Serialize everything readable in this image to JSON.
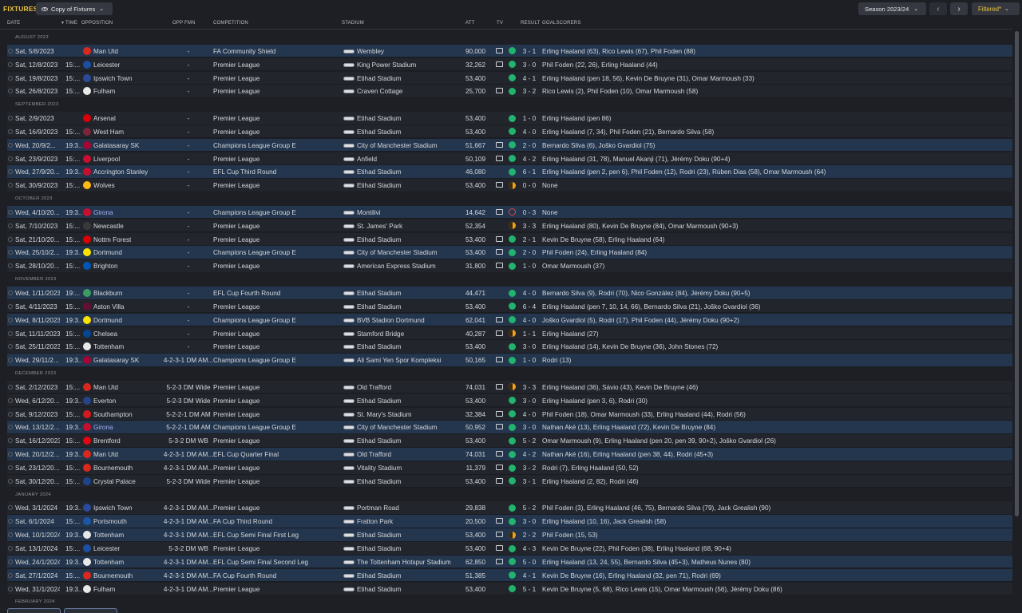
{
  "header": {
    "title": "FIXTURES",
    "view": "Copy of Fixtures",
    "season": "Season 2023/24",
    "filter": "Filtered*"
  },
  "columns": {
    "date": "DATE",
    "time": "TIME",
    "opposition": "OPPOSITION",
    "opp_fmn": "OPP FMN",
    "competition": "COMPETITION",
    "stadium": "STADIUM",
    "att": "ATT",
    "tv": "TV",
    "result": "RESULT",
    "goalscorers": "GOALSCORERS"
  },
  "colors": {
    "accent": "#e9c23b",
    "win": "#22b36f",
    "draw": "#f0a11f",
    "loss": "#e24848",
    "highlight_row": "#23364e"
  },
  "groups": [
    {
      "month": "AUGUST 2023",
      "rows": [
        {
          "date": "Sat, 5/8/2023",
          "time": "",
          "opp": "Man Utd",
          "crest": "#d9291c",
          "fmn": "-",
          "comp": "FA Community Shield",
          "stadium": "Wembley",
          "att": "90,000",
          "tv": true,
          "res": "w",
          "score": "3 - 1",
          "goals": "Erling Haaland (63), Rico Lewis (67), Phil Foden (88)",
          "hl": true
        },
        {
          "date": "Sat, 12/8/2023",
          "time": "15:...",
          "opp": "Leicester",
          "crest": "#1c4fa3",
          "fmn": "-",
          "comp": "Premier League",
          "stadium": "King Power Stadium",
          "att": "32,262",
          "tv": true,
          "res": "w",
          "score": "3 - 0",
          "goals": "Phil Foden (22, 26), Erling Haaland (44)"
        },
        {
          "date": "Sat, 19/8/2023",
          "time": "15:...",
          "opp": "Ipswich Town",
          "crest": "#2a4a9c",
          "fmn": "-",
          "comp": "Premier League",
          "stadium": "Etihad Stadium",
          "att": "53,400",
          "tv": false,
          "res": "w",
          "score": "4 - 1",
          "goals": "Erling Haaland (pen 18, 56), Kevin De Bruyne (31), Omar Marmoush (33)"
        },
        {
          "date": "Sat, 26/8/2023",
          "time": "15:...",
          "opp": "Fulham",
          "crest": "#e8e8e8",
          "fmn": "-",
          "comp": "Premier League",
          "stadium": "Craven Cottage",
          "att": "25,700",
          "tv": true,
          "res": "w",
          "score": "3 - 2",
          "goals": "Rico Lewis (2), Phil Foden (10), Omar Marmoush (58)"
        }
      ]
    },
    {
      "month": "SEPTEMBER 2023",
      "rows": [
        {
          "date": "Sat, 2/9/2023",
          "time": "",
          "opp": "Arsenal",
          "crest": "#db0007",
          "fmn": "-",
          "comp": "Premier League",
          "stadium": "Etihad Stadium",
          "att": "53,400",
          "tv": false,
          "res": "w",
          "score": "1 - 0",
          "goals": "Erling Haaland (pen 86)"
        },
        {
          "date": "Sat, 16/9/2023",
          "time": "15:...",
          "opp": "West Ham",
          "crest": "#7a263a",
          "fmn": "-",
          "comp": "Premier League",
          "stadium": "Etihad Stadium",
          "att": "53,400",
          "tv": false,
          "res": "w",
          "score": "4 - 0",
          "goals": "Erling Haaland (7, 34), Phil Foden (21), Bernardo Silva (58)"
        },
        {
          "date": "Wed, 20/9/2...",
          "time": "19:3...",
          "opp": "Galatasaray SK",
          "crest": "#a90432",
          "fmn": "-",
          "comp": "Champions League Group E",
          "stadium": "City of Manchester Stadium",
          "att": "51,667",
          "tv": true,
          "res": "w",
          "score": "2 - 0",
          "goals": "Bernardo Silva (6), Joško Gvardiol (75)",
          "hl": true
        },
        {
          "date": "Sat, 23/9/2023",
          "time": "15:...",
          "opp": "Liverpool",
          "crest": "#c8102e",
          "fmn": "-",
          "comp": "Premier League",
          "stadium": "Anfield",
          "att": "50,109",
          "tv": true,
          "res": "w",
          "score": "4 - 2",
          "goals": "Erling Haaland (31, 78), Manuel Akanji (71), Jérémy Doku (90+4)"
        },
        {
          "date": "Wed, 27/9/20...",
          "time": "19:3...",
          "opp": "Accrington Stanley",
          "crest": "#c8102e",
          "fmn": "-",
          "comp": "EFL Cup Third Round",
          "stadium": "Etihad Stadium",
          "att": "46,080",
          "tv": false,
          "res": "w",
          "score": "6 - 1",
          "goals": "Erling Haaland (pen 2, pen 6), Phil Foden (12), Rodri (23), Rúben Dias (58), Omar Marmoush (64)",
          "hl": true
        },
        {
          "date": "Sat, 30/9/2023",
          "time": "15:...",
          "opp": "Wolves",
          "crest": "#fdb913",
          "fmn": "-",
          "comp": "Premier League",
          "stadium": "Etihad Stadium",
          "att": "53,400",
          "tv": true,
          "res": "d",
          "score": "0 - 0",
          "goals": "None"
        }
      ]
    },
    {
      "month": "OCTOBER 2023",
      "rows": [
        {
          "date": "Wed, 4/10/20...",
          "time": "19:3...",
          "opp": "Girona",
          "crest": "#c8102e",
          "fmn": "-",
          "comp": "Champions League Group E",
          "stadium": "Montilivi",
          "att": "14,642",
          "tv": true,
          "res": "l",
          "score": "0 - 3",
          "goals": "None",
          "hl": true,
          "girona": true
        },
        {
          "date": "Sat, 7/10/2023",
          "time": "15:...",
          "opp": "Newcastle",
          "crest": "#3a3a3a",
          "fmn": "-",
          "comp": "Premier League",
          "stadium": "St. James' Park",
          "att": "52,354",
          "tv": false,
          "res": "d",
          "score": "3 - 3",
          "goals": "Erling Haaland (80), Kevin De Bruyne (84), Omar Marmoush (90+3)"
        },
        {
          "date": "Sat, 21/10/20...",
          "time": "15:...",
          "opp": "Nottm Forest",
          "crest": "#dd0000",
          "fmn": "-",
          "comp": "Premier League",
          "stadium": "Etihad Stadium",
          "att": "53,400",
          "tv": true,
          "res": "w",
          "score": "2 - 1",
          "goals": "Kevin De Bruyne (58), Erling Haaland (64)"
        },
        {
          "date": "Wed, 25/10/2...",
          "time": "19:3...",
          "opp": "Dortmund",
          "crest": "#fde100",
          "fmn": "-",
          "comp": "Champions League Group E",
          "stadium": "City of Manchester Stadium",
          "att": "53,400",
          "tv": true,
          "res": "w",
          "score": "2 - 0",
          "goals": "Phil Foden (24), Erling Haaland (84)",
          "hl": true
        },
        {
          "date": "Sat, 28/10/20...",
          "time": "15:...",
          "opp": "Brighton",
          "crest": "#0057b8",
          "fmn": "-",
          "comp": "Premier League",
          "stadium": "American Express Stadium",
          "att": "31,800",
          "tv": true,
          "res": "w",
          "score": "1 - 0",
          "goals": "Omar Marmoush (37)"
        }
      ]
    },
    {
      "month": "NOVEMBER 2023",
      "rows": [
        {
          "date": "Wed, 1/11/2023",
          "time": "19:...",
          "opp": "Blackburn",
          "crest": "#3c9a63",
          "fmn": "-",
          "comp": "EFL Cup Fourth Round",
          "stadium": "Etihad Stadium",
          "att": "44,471",
          "tv": false,
          "res": "w",
          "score": "4 - 0",
          "goals": "Bernardo Silva (9), Rodri (70), Nico González (84), Jérémy Doku (90+5)",
          "hl": true
        },
        {
          "date": "Sat, 4/11/2023",
          "time": "15:...",
          "opp": "Aston Villa",
          "crest": "#670e36",
          "fmn": "-",
          "comp": "Premier League",
          "stadium": "Etihad Stadium",
          "att": "53,400",
          "tv": false,
          "res": "w",
          "score": "6 - 4",
          "goals": "Erling Haaland (pen 7, 10, 14, 66), Bernardo Silva (21), Joško Gvardiol (36)"
        },
        {
          "date": "Wed, 8/11/2023",
          "time": "19:3...",
          "opp": "Dortmund",
          "crest": "#fde100",
          "fmn": "-",
          "comp": "Champions League Group E",
          "stadium": "BVB Stadion Dortmund",
          "att": "62,041",
          "tv": true,
          "res": "w",
          "score": "4 - 0",
          "goals": "Joško Gvardiol (5), Rodri (17), Phil Foden (44), Jérémy Doku (90+2)",
          "hl": true
        },
        {
          "date": "Sat, 11/11/2023",
          "time": "15:...",
          "opp": "Chelsea",
          "crest": "#034694",
          "fmn": "-",
          "comp": "Premier League",
          "stadium": "Stamford Bridge",
          "att": "40,287",
          "tv": true,
          "res": "d",
          "score": "1 - 1",
          "goals": "Erling Haaland (27)"
        },
        {
          "date": "Sat, 25/11/2023",
          "time": "15:...",
          "opp": "Tottenham",
          "crest": "#e8e8e8",
          "fmn": "-",
          "comp": "Premier League",
          "stadium": "Etihad Stadium",
          "att": "53,400",
          "tv": false,
          "res": "w",
          "score": "3 - 0",
          "goals": "Erling Haaland (14), Kevin De Bruyne (36), John Stones (72)"
        },
        {
          "date": "Wed, 29/11/2...",
          "time": "19:3...",
          "opp": "Galatasaray SK",
          "crest": "#a90432",
          "fmn": "4-2-3-1 DM AM...",
          "comp": "Champions League Group E",
          "stadium": "Ali Sami Yen Spor Kompleksi",
          "att": "50,165",
          "tv": true,
          "res": "w",
          "score": "1 - 0",
          "goals": "Rodri (13)",
          "hl": true
        }
      ]
    },
    {
      "month": "DECEMBER 2023",
      "rows": [
        {
          "date": "Sat, 2/12/2023",
          "time": "15:...",
          "opp": "Man Utd",
          "crest": "#d9291c",
          "fmn": "5-2-3 DM Wide",
          "comp": "Premier League",
          "stadium": "Old Trafford",
          "att": "74,031",
          "tv": true,
          "res": "d",
          "score": "3 - 3",
          "goals": "Erling Haaland (36), Sávio (43), Kevin De Bruyne (46)"
        },
        {
          "date": "Wed, 6/12/20...",
          "time": "19:3...",
          "opp": "Everton",
          "crest": "#274488",
          "fmn": "5-2-3 DM Wide",
          "comp": "Premier League",
          "stadium": "Etihad Stadium",
          "att": "53,400",
          "tv": false,
          "res": "w",
          "score": "3 - 0",
          "goals": "Erling Haaland (pen 3, 6), Rodri (30)"
        },
        {
          "date": "Sat, 9/12/2023",
          "time": "15:...",
          "opp": "Southampton",
          "crest": "#d71920",
          "fmn": "5-2-2-1 DM AM",
          "comp": "Premier League",
          "stadium": "St. Mary's Stadium",
          "att": "32,384",
          "tv": true,
          "res": "w",
          "score": "4 - 0",
          "goals": "Phil Foden (18), Omar Marmoush (33), Erling Haaland (44), Rodri (56)"
        },
        {
          "date": "Wed, 13/12/2...",
          "time": "19:3...",
          "opp": "Girona",
          "crest": "#c8102e",
          "fmn": "5-2-2-1 DM AM",
          "comp": "Champions League Group E",
          "stadium": "City of Manchester Stadium",
          "att": "50,952",
          "tv": true,
          "res": "w",
          "score": "3 - 0",
          "goals": "Nathan Aké (13), Erling Haaland (72), Kevin De Bruyne (84)",
          "hl": true,
          "girona": true
        },
        {
          "date": "Sat, 16/12/2023",
          "time": "15:...",
          "opp": "Brentford",
          "crest": "#e30613",
          "fmn": "5-3-2 DM WB",
          "comp": "Premier League",
          "stadium": "Etihad Stadium",
          "att": "53,400",
          "tv": false,
          "res": "w",
          "score": "5 - 2",
          "goals": "Omar Marmoush (9), Erling Haaland (pen 20, pen 39, 90+2), Joško Gvardiol (26)"
        },
        {
          "date": "Wed, 20/12/2...",
          "time": "19:3...",
          "opp": "Man Utd",
          "crest": "#d9291c",
          "fmn": "4-2-3-1 DM AM...",
          "comp": "EFL Cup Quarter Final",
          "stadium": "Old Trafford",
          "att": "74,031",
          "tv": true,
          "res": "w",
          "score": "4 - 2",
          "goals": "Nathan Aké (16), Erling Haaland (pen 38, 44), Rodri (45+3)",
          "hl": true
        },
        {
          "date": "Sat, 23/12/20...",
          "time": "15:...",
          "opp": "Bournemouth",
          "crest": "#da291c",
          "fmn": "4-2-3-1 DM AM...",
          "comp": "Premier League",
          "stadium": "Vitality Stadium",
          "att": "11,379",
          "tv": true,
          "res": "w",
          "score": "3 - 2",
          "goals": "Rodri (7), Erling Haaland (50, 52)"
        },
        {
          "date": "Sat, 30/12/20...",
          "time": "15:...",
          "opp": "Crystal Palace",
          "crest": "#1b458f",
          "fmn": "5-2-3 DM Wide",
          "comp": "Premier League",
          "stadium": "Etihad Stadium",
          "att": "53,400",
          "tv": true,
          "res": "w",
          "score": "3 - 1",
          "goals": "Erling Haaland (2, 82), Rodri (46)"
        }
      ]
    },
    {
      "month": "JANUARY 2024",
      "rows": [
        {
          "date": "Wed, 3/1/2024",
          "time": "19:3...",
          "opp": "Ipswich Town",
          "crest": "#2a4a9c",
          "fmn": "4-2-3-1 DM AM...",
          "comp": "Premier League",
          "stadium": "Portman Road",
          "att": "29,838",
          "tv": false,
          "res": "w",
          "score": "5 - 2",
          "goals": "Phil Foden (3), Erling Haaland (46, 75), Bernardo Silva (79), Jack Grealish (90)"
        },
        {
          "date": "Sat, 6/1/2024",
          "time": "15:...",
          "opp": "Portsmouth",
          "crest": "#1c56a6",
          "fmn": "4-2-3-1 DM AM...",
          "comp": "FA Cup Third Round",
          "stadium": "Fratton Park",
          "att": "20,500",
          "tv": true,
          "res": "w",
          "score": "3 - 0",
          "goals": "Erling Haaland (10, 16), Jack Grealish (58)",
          "hl": true
        },
        {
          "date": "Wed, 10/1/2024",
          "time": "19:3...",
          "opp": "Tottenham",
          "crest": "#e8e8e8",
          "fmn": "4-2-3-1 DM AM...",
          "comp": "EFL Cup Semi Final First Leg",
          "stadium": "Etihad Stadium",
          "att": "53,400",
          "tv": true,
          "res": "d",
          "score": "2 - 2",
          "goals": "Phil Foden (15, 53)",
          "hl": true
        },
        {
          "date": "Sat, 13/1/2024",
          "time": "15:...",
          "opp": "Leicester",
          "crest": "#1c4fa3",
          "fmn": "5-3-2 DM WB",
          "comp": "Premier League",
          "stadium": "Etihad Stadium",
          "att": "53,400",
          "tv": true,
          "res": "w",
          "score": "4 - 3",
          "goals": "Kevin De Bruyne (22), Phil Foden (38), Erling Haaland (68, 90+4)"
        },
        {
          "date": "Wed, 24/1/2024",
          "time": "19:3...",
          "opp": "Tottenham",
          "crest": "#e8e8e8",
          "fmn": "4-2-3-1 DM AM...",
          "comp": "EFL Cup Semi Final Second Leg",
          "stadium": "The Tottenham Hotspur Stadium",
          "att": "62,850",
          "tv": true,
          "res": "w",
          "score": "5 - 0",
          "goals": "Erling Haaland (13, 24, 55), Bernardo Silva (45+3), Matheus Nunes (80)",
          "hl": true
        },
        {
          "date": "Sat, 27/1/2024",
          "time": "15:...",
          "opp": "Bournemouth",
          "crest": "#da291c",
          "fmn": "4-2-3-1 DM AM...",
          "comp": "FA Cup Fourth Round",
          "stadium": "Etihad Stadium",
          "att": "51,385",
          "tv": false,
          "res": "w",
          "score": "4 - 1",
          "goals": "Kevin De Bruyne (16), Erling Haaland (32, pen 71), Rodri (69)",
          "hl": true
        },
        {
          "date": "Wed, 31/1/2024",
          "time": "19:3...",
          "opp": "Fulham",
          "crest": "#e8e8e8",
          "fmn": "4-2-3-1 DM AM...",
          "comp": "Premier League",
          "stadium": "Etihad Stadium",
          "att": "53,400",
          "tv": false,
          "res": "w",
          "score": "5 - 1",
          "goals": "Kevin De Bruyne (5, 68), Rico Lewis (15), Omar Marmoush (56), Jérémy Doku (86)"
        }
      ]
    },
    {
      "month": "FEBRUARY 2024",
      "rows": []
    }
  ]
}
